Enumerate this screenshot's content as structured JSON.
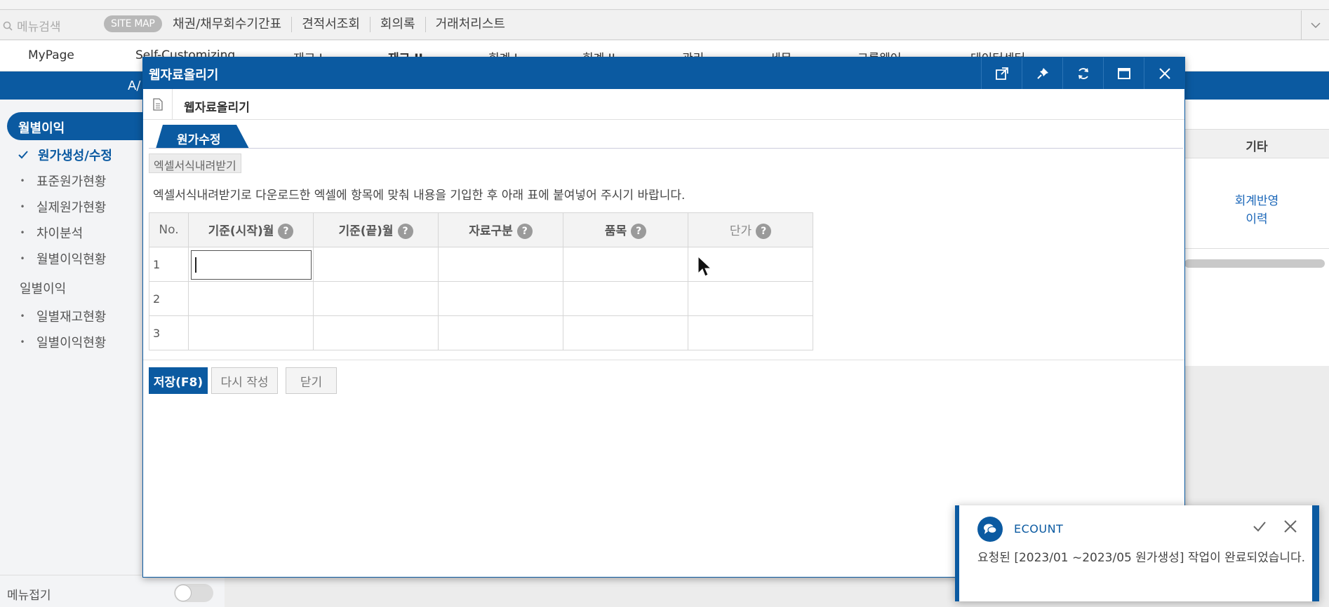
{
  "search": {
    "placeholder": "메뉴검색"
  },
  "sitemap_label": "SITE MAP",
  "quicklinks": [
    "채권/채무회수기간표",
    "견적서조회",
    "회의록",
    "거래처리스트"
  ],
  "mainmenu": [
    "MyPage",
    "Self-Customizing",
    "재고 I",
    "재고 II",
    "회계 I",
    "회계 II",
    "관리",
    "세무",
    "그룹웨어",
    "데이터센터"
  ],
  "bluebar_text": "A/",
  "sidebar": {
    "active_group": "월별이익",
    "items": [
      {
        "label": "원가생성/수정",
        "active": true
      },
      {
        "label": "표준원가현황"
      },
      {
        "label": "실제원가현황"
      },
      {
        "label": "차이분석"
      },
      {
        "label": "월별이익현황"
      }
    ],
    "group2": "일별이익",
    "items2": [
      {
        "label": "일별재고현황"
      },
      {
        "label": "일별이익현황"
      }
    ],
    "footer_label": "메뉴접기"
  },
  "background": {
    "header": "기타",
    "link_line1": "회계반영",
    "link_line2": "이력"
  },
  "dialog": {
    "title": "웹자료올리기",
    "subtitle": "웹자료올리기",
    "tab": "원가수정",
    "excel_button": "엑셀서식내려받기",
    "guide_text": "엑셀서식내려받기로 다운로드한 엑셀에 항목에 맞춰 내용을 기입한 후 아래 표에 붙여넣어 주시기 바랍니다.",
    "table": {
      "headers": [
        "No.",
        "기준(시작)월",
        "기준(끝)월",
        "자료구분",
        "품목",
        "단가"
      ],
      "rows": [
        "1",
        "2",
        "3"
      ]
    },
    "buttons": {
      "save": "저장(F8)",
      "rewrite": "다시 작성",
      "close": "닫기"
    }
  },
  "toast": {
    "title": "ECOUNT",
    "message": "요청된 [2023/01 ~2023/05 원가생성] 작업이 완료되었습니다."
  },
  "colors": {
    "primary": "#0b5aa1",
    "link": "#1a66b8"
  }
}
